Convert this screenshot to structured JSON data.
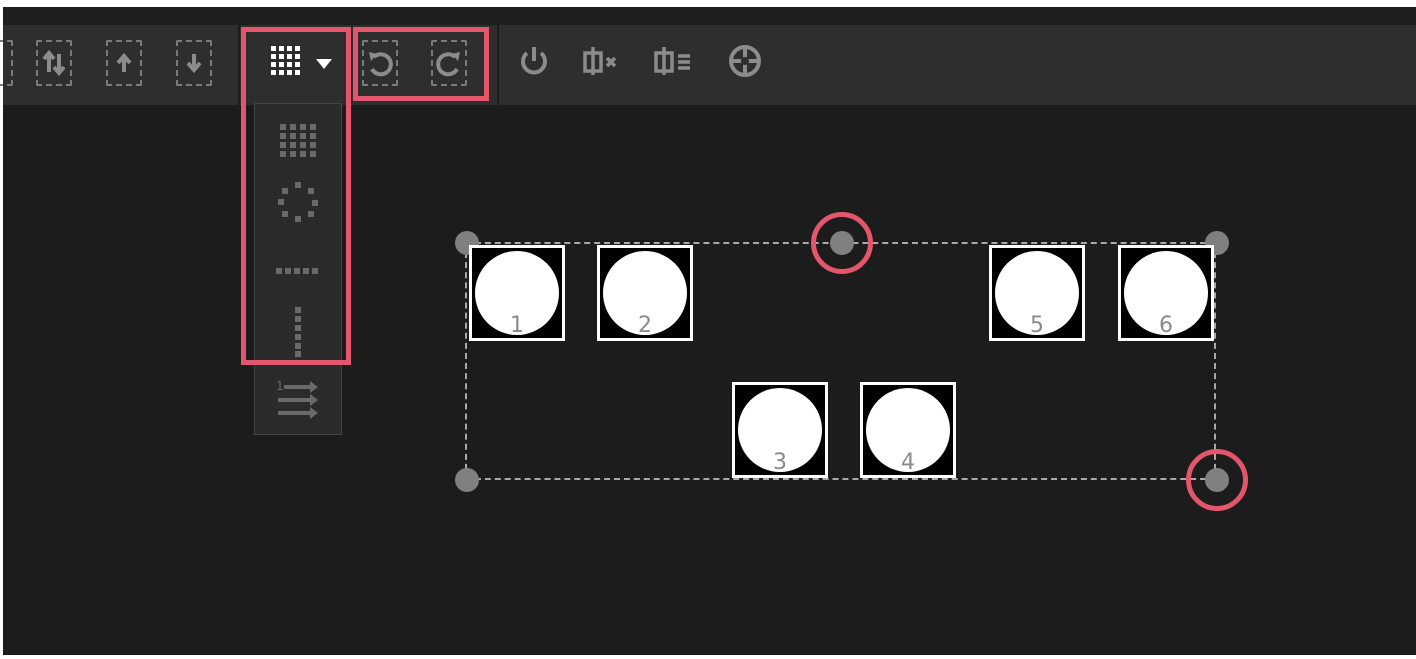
{
  "toolbar": {
    "left_buttons": [
      {
        "name": "partial-edge-icon"
      },
      {
        "name": "swap-order-icon"
      },
      {
        "name": "move-up-icon"
      },
      {
        "name": "move-down-icon"
      }
    ],
    "arrange_dropdown": {
      "selected_icon": "grid-icon",
      "caret_icon": "caret-down-icon"
    },
    "undo_icon": "undo-icon",
    "redo_icon": "redo-icon",
    "right_icons": [
      "power-icon",
      "fixture-clear-icon",
      "fixture-list-icon",
      "crosshair-icon"
    ]
  },
  "arrange_menu": {
    "items": [
      {
        "name": "arrange-grid-icon"
      },
      {
        "name": "arrange-circle-icon"
      },
      {
        "name": "arrange-row-icon"
      },
      {
        "name": "arrange-column-icon"
      },
      {
        "name": "arrange-numbered-order-icon"
      }
    ]
  },
  "fixtures": [
    {
      "label": "1"
    },
    {
      "label": "2"
    },
    {
      "label": "3"
    },
    {
      "label": "4"
    },
    {
      "label": "5"
    },
    {
      "label": "6"
    }
  ],
  "colors": {
    "highlight": "#e3566b",
    "background": "#1c1c1c",
    "toolbar": "#2e2e2e",
    "handle": "#808080"
  }
}
